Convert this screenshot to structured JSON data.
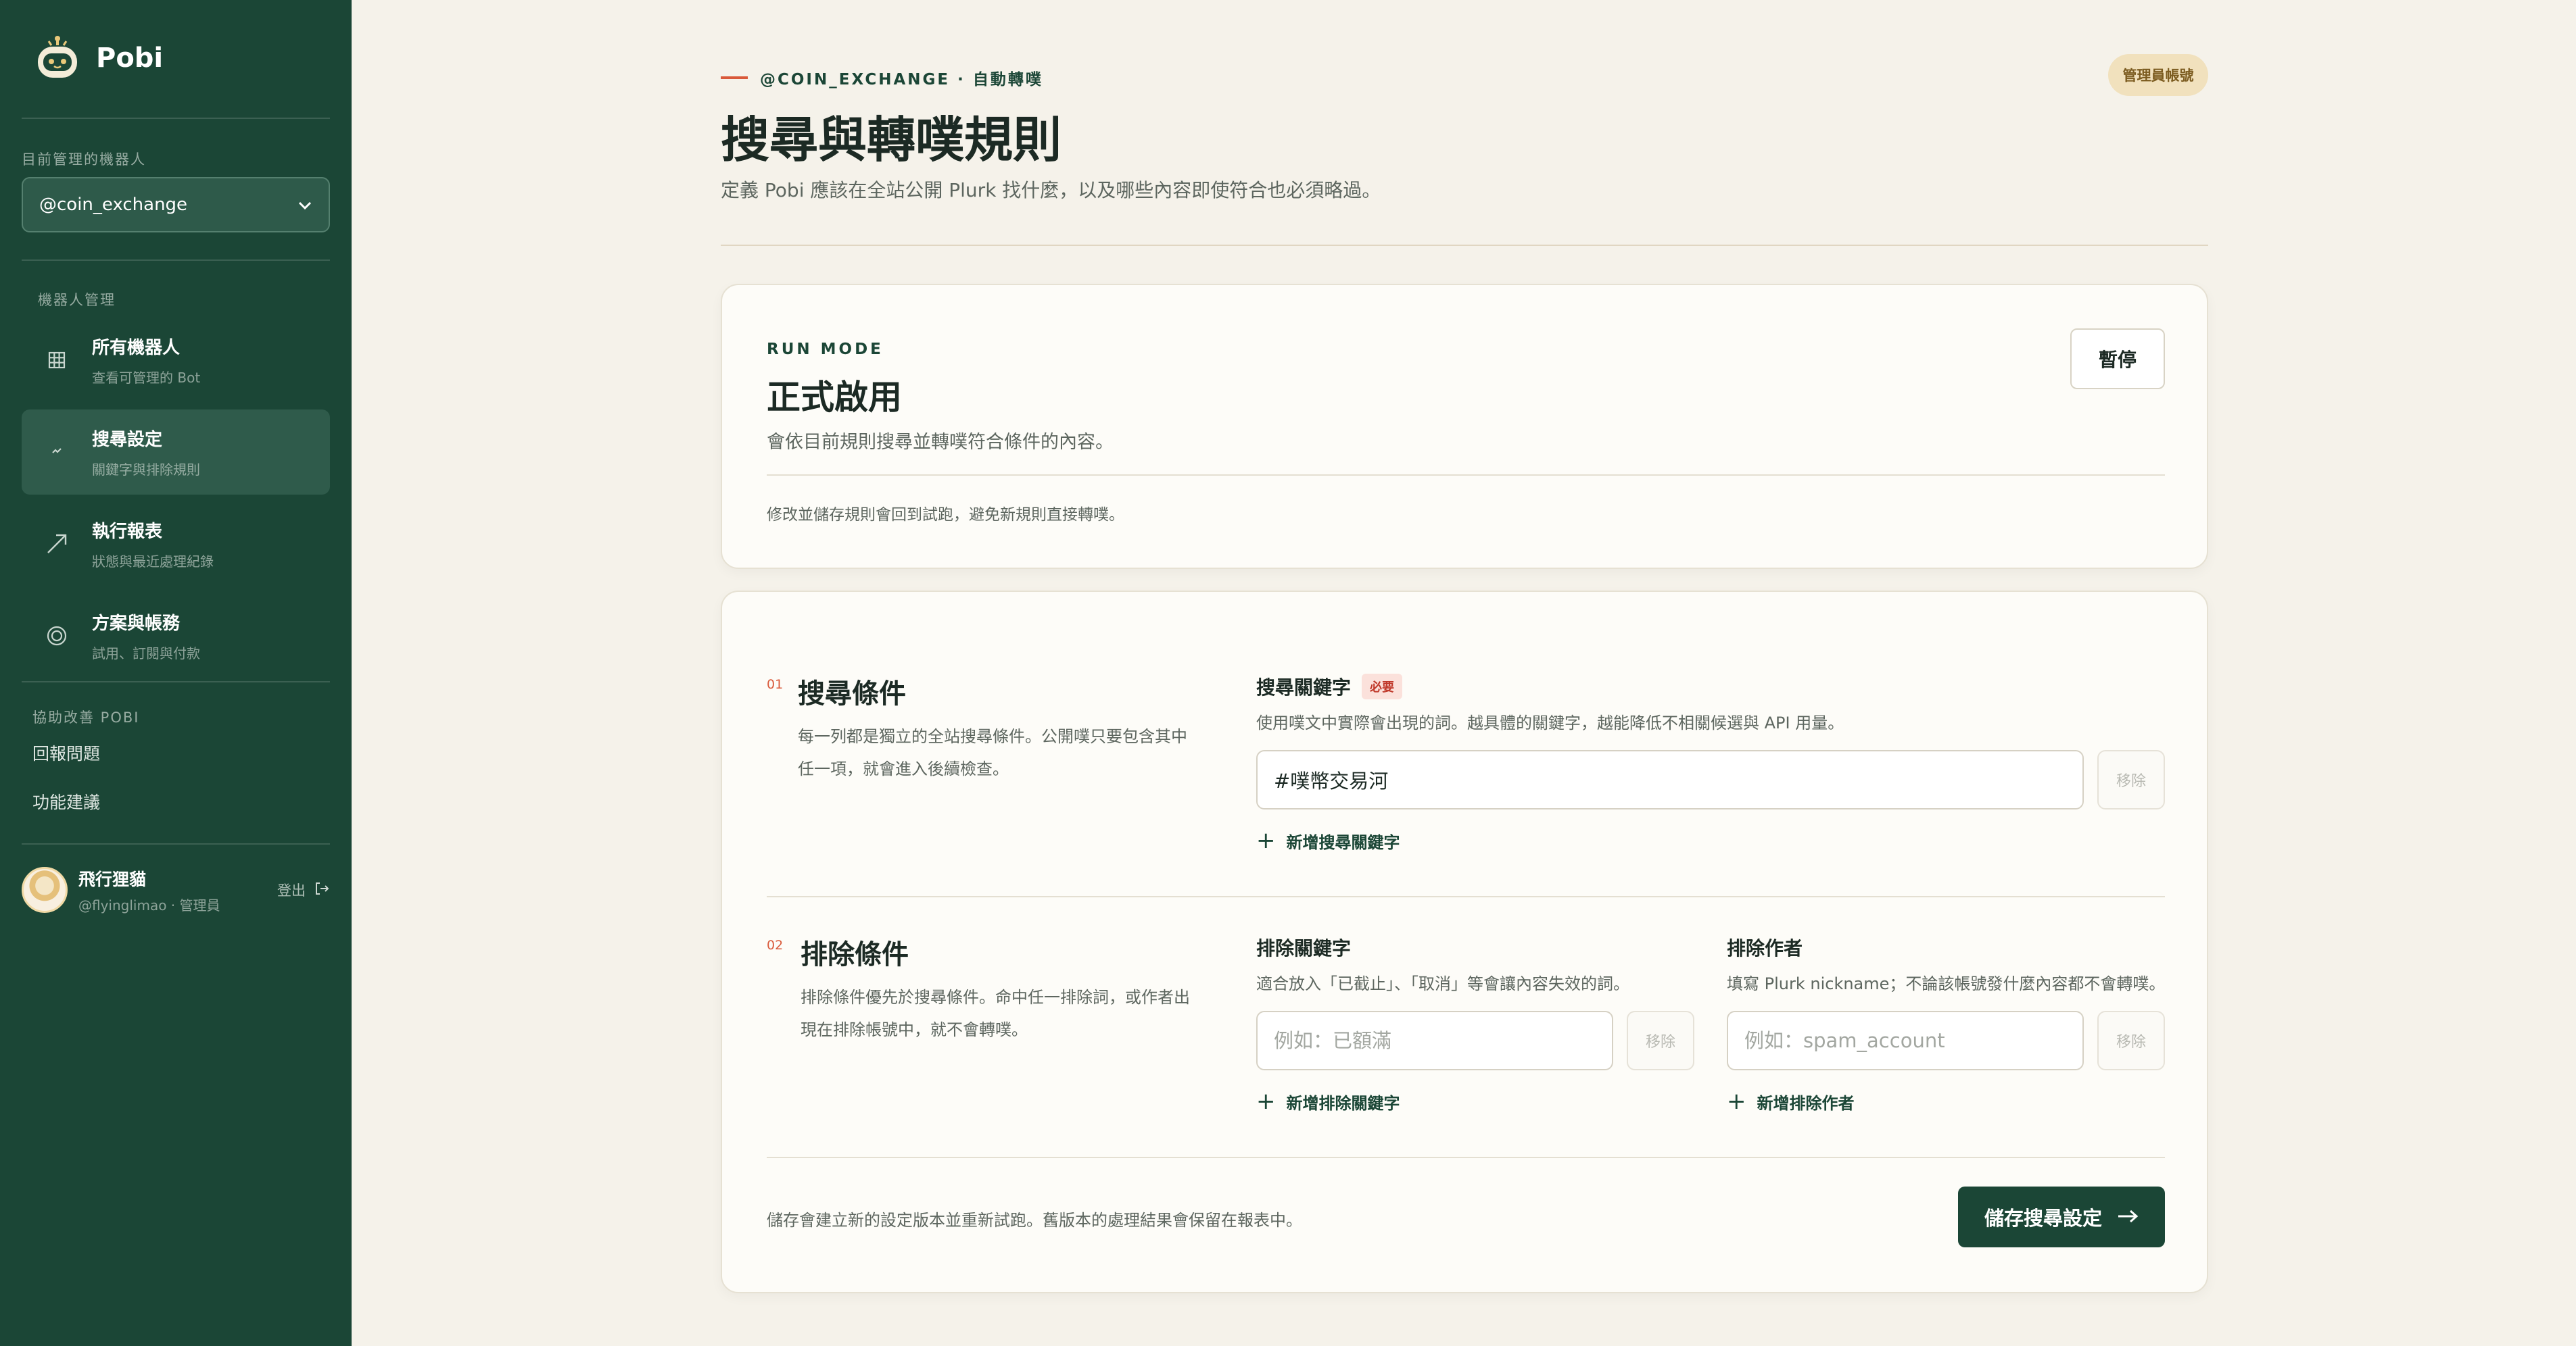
{
  "brand": {
    "name": "Pobi"
  },
  "sidebar": {
    "bot_label": "目前管理的機器人",
    "bot_selected": "@coin_exchange",
    "section_label": "機器人管理",
    "nav": [
      {
        "title": "所有機器人",
        "sub": "查看可管理的 Bot",
        "icon": "grid-icon"
      },
      {
        "title": "搜尋設定",
        "sub": "關鍵字與排除規則",
        "icon": "search-settings-icon"
      },
      {
        "title": "執行報表",
        "sub": "狀態與最近處理紀錄",
        "icon": "trend-arrow-icon"
      },
      {
        "title": "方案與帳務",
        "sub": "試用、訂閱與付款",
        "icon": "ring-icon"
      }
    ],
    "help_label": "協助改善 POBI",
    "help_links": [
      "回報問題",
      "功能建議"
    ],
    "user": {
      "name": "飛行狸貓",
      "handle": "@flyinglimao · 管理員",
      "logout": "登出"
    }
  },
  "header": {
    "eyebrow": "@COIN_EXCHANGE · 自動轉噗",
    "badge": "管理員帳號",
    "title": "搜尋與轉噗規則",
    "subtitle": "定義 Pobi 應該在全站公開 Plurk 找什麼，以及哪些內容即使符合也必須略過。"
  },
  "run_mode": {
    "label": "RUN MODE",
    "title": "正式啟用",
    "desc": "會依目前規則搜尋並轉噗符合條件的內容。",
    "note": "修改並儲存規則會回到試跑，避免新規則直接轉噗。",
    "pause": "暫停"
  },
  "search_section": {
    "num": "01",
    "title": "搜尋條件",
    "desc": "每一列都是獨立的全站搜尋條件。公開噗只要包含其中任一項，就會進入後續檢查。",
    "field_label": "搜尋關鍵字",
    "required": "必要",
    "help": "使用噗文中實際會出現的詞。越具體的關鍵字，越能降低不相關候選與 API 用量。",
    "keyword_value": "#噗幣交易河",
    "remove": "移除",
    "add": "新增搜尋關鍵字"
  },
  "exclude_section": {
    "num": "02",
    "title": "排除條件",
    "desc": "排除條件優先於搜尋條件。命中任一排除詞，或作者出現在排除帳號中，就不會轉噗。",
    "kw_label": "排除關鍵字",
    "kw_help": "適合放入「已截止」、「取消」等會讓內容失效的詞。",
    "kw_placeholder": "例如：已額滿",
    "kw_add": "新增排除關鍵字",
    "author_label": "排除作者",
    "author_help": "填寫 Plurk nickname；不論該帳號發什麼內容都不會轉噗。",
    "author_placeholder": "例如：spam_account",
    "author_add": "新增排除作者",
    "remove": "移除"
  },
  "footer": {
    "note": "儲存會建立新的設定版本並重新試跑。舊版本的處理結果會保留在報表中。",
    "save": "儲存搜尋設定"
  }
}
